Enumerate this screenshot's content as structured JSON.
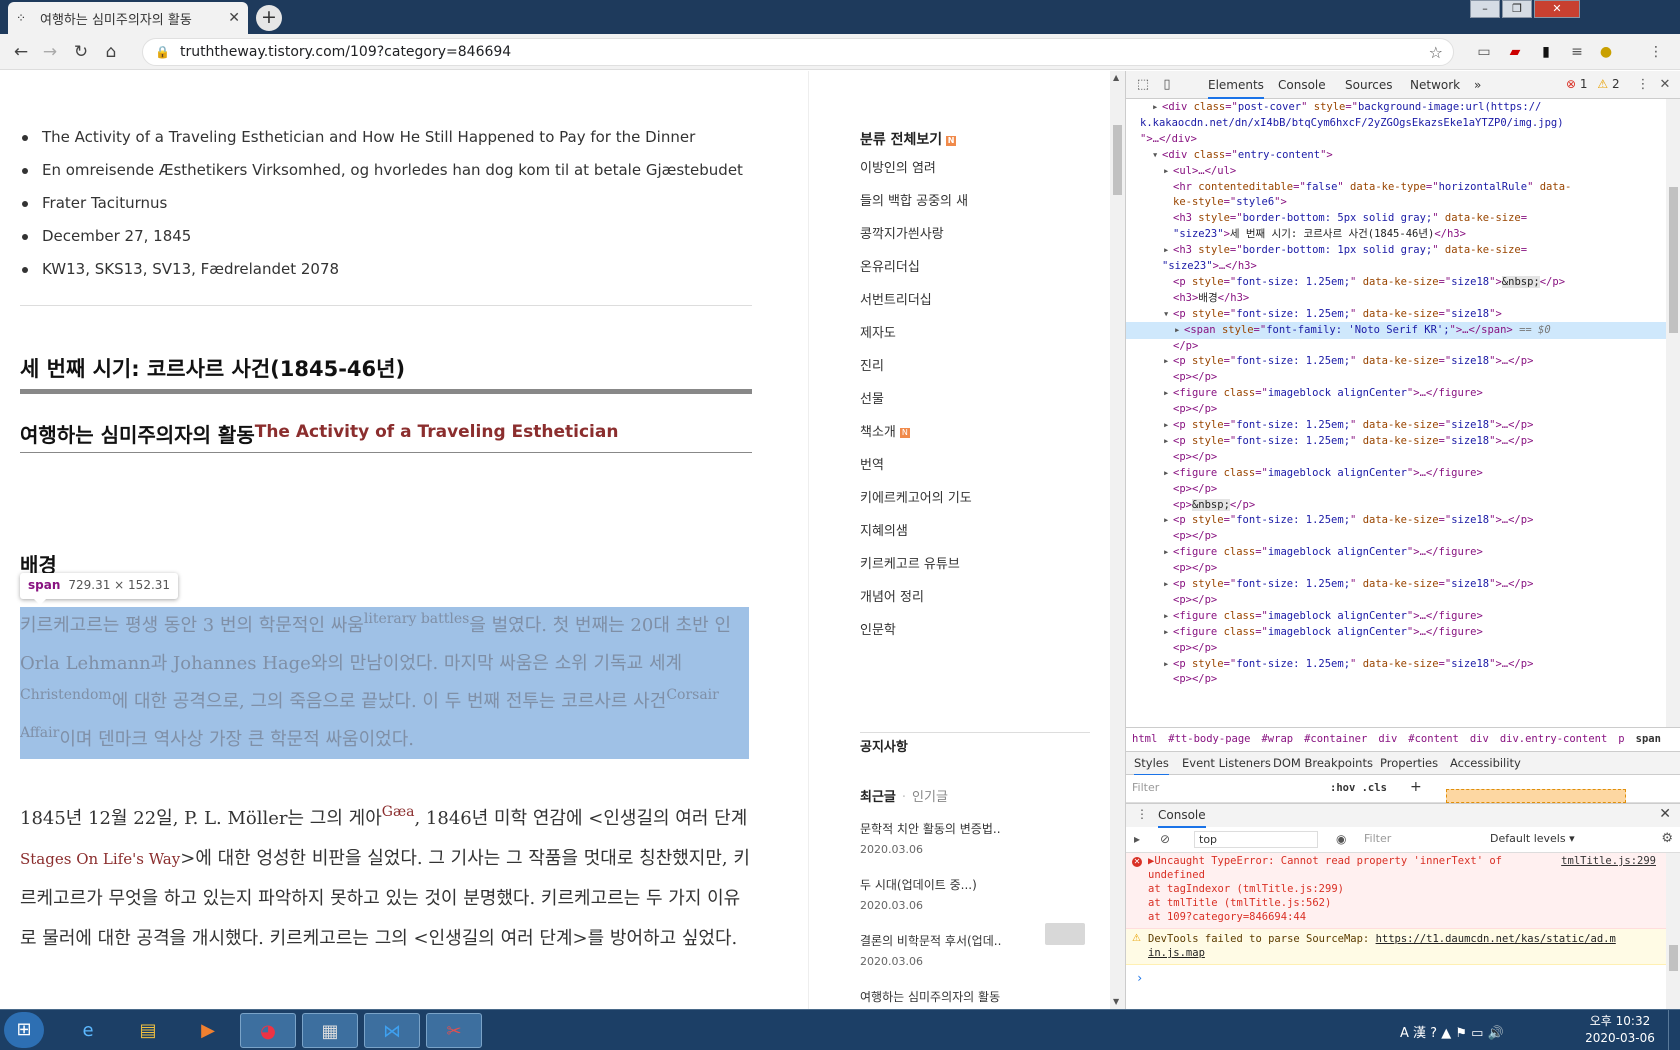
{
  "browser": {
    "tab_title": "여행하는 심미주의자의 활동",
    "url": "truththeway.tistory.com/109?category=846694",
    "new_tab_label": "+",
    "tab_close": "✕",
    "window_controls": [
      "–",
      "❐",
      "✕"
    ]
  },
  "article": {
    "meta_items": [
      "The Activity of a Traveling Esthetician and How He Still Happened to Pay for the Dinner",
      "En omreisende Æsthetikers Virksomhed, og hvorledes han dog kom til at betale Gjæstebudet",
      "Frater Taciturnus",
      "December 27, 1845",
      "KW13, SKS13, SV13, Fædrelandet 2078"
    ],
    "heading_period": "세 번째 시기: 코르사르 사건(1845-46년)",
    "heading_title": "여행하는 심미주의자의 활동",
    "heading_title_en": "The Activity of a Traveling Esthetician",
    "heading_background": "배경",
    "tooltip_tag": "span",
    "tooltip_dims": "729.31 × 152.31",
    "para1": {
      "a": "키르케고르는 평생 동안 3 번의 학문적인 싸움",
      "sup1": "literary battles",
      "b": "을 벌였다. 첫 번째는 20대 초반 인 Orla Lehmann과 Johannes Hage와의 만남이었다. 마지막 싸움은 소위 기독교 세계",
      "sup2": "Christendom",
      "c": "에 대한 공격으로, 그의 죽음으로 끝났다. 이 두 번째 전투는 코르사르 사건",
      "sup3": "Corsair Affair",
      "d": "이며 덴마크 역사상 가장 큰 학문적 싸움이었다."
    },
    "para2": {
      "a": "1845년 12월 22일, P. L. Möller는 그의 게아",
      "sup1": "Gæa",
      "b": ", 1846년 미학 연감에 <인생길의 여러 단계 ",
      "link": "Stages On Life's Way",
      "c": ">에 대한 엉성한 비판을 실었다. 그 기사는 그 작품을 멋대로 칭찬했지만, 키르케고르가 무엇을 하고 있는지 파악하지 못하고 있는 것이 분명했다. 키르케고르는 두 가지 이유로 물러에 대한 공격을 개시했다. 키르케고르는 그의 <인생길의 여러 단계>를 방어하고 싶었다."
    }
  },
  "sidebar": {
    "category_head": "분류 전체보기",
    "new_badge": "N",
    "categories": [
      "이방인의 염려",
      "들의 백합 공중의 새",
      "콩깍지가씐사랑",
      "온유리더십",
      "서번트리더십",
      "제자도",
      "진리",
      "선물",
      "책소개",
      "번역",
      "키에르케고어의 기도",
      "지혜의샘",
      "키르케고르 유튜브",
      "개념어 정리",
      "인문학"
    ],
    "notice": "공지사항",
    "recent_tab": "최근글",
    "popular_tab": "인기글",
    "recent_posts": [
      {
        "title": "문학적 치안 활동의 변증법..",
        "date": "2020.03.06"
      },
      {
        "title": "두 시대(업데이트 중...)",
        "date": "2020.03.06"
      },
      {
        "title": "결론의 비학문적 후서(업데..",
        "date": "2020.03.06"
      },
      {
        "title": "여행하는 심미주의자의 활동",
        "date": ""
      }
    ]
  },
  "devtools": {
    "tabs": [
      "Elements",
      "Console",
      "Sources",
      "Network",
      "»"
    ],
    "error_count": "1",
    "warning_count": "2",
    "dom_lines": [
      {
        "indent": 2,
        "arrow": "▶",
        "parts": [
          [
            "tagn",
            "<div "
          ],
          [
            "attr",
            "class"
          ],
          [
            "tagn",
            "=\""
          ],
          [
            "val",
            "post-cover"
          ],
          [
            "tagn",
            "\" "
          ],
          [
            "attr",
            "style"
          ],
          [
            "tagn",
            "=\""
          ],
          [
            "val",
            "background-image:url(https://"
          ]
        ]
      },
      {
        "indent": 0,
        "arrow": "",
        "parts": [
          [
            "val",
            "k.kakaocdn.net/dn/xI4bB/btqCym6hxcF/2yZGOgsEkazsEke1aYTZP0/img.jpg)"
          ]
        ]
      },
      {
        "indent": 0,
        "arrow": "",
        "parts": [
          [
            "tagn",
            "\">…</div>"
          ]
        ]
      },
      {
        "indent": 2,
        "arrow": "▼",
        "parts": [
          [
            "tagn",
            "<div "
          ],
          [
            "attr",
            "class"
          ],
          [
            "tagn",
            "=\""
          ],
          [
            "val",
            "entry-content"
          ],
          [
            "tagn",
            "\">"
          ]
        ]
      },
      {
        "indent": 3,
        "arrow": "▶",
        "parts": [
          [
            "tagn",
            "<ul>…</ul>"
          ]
        ]
      },
      {
        "indent": 3,
        "arrow": "",
        "parts": [
          [
            "tagn",
            "<hr "
          ],
          [
            "attr",
            "contenteditable"
          ],
          [
            "tagn",
            "=\""
          ],
          [
            "val",
            "false"
          ],
          [
            "tagn",
            "\" "
          ],
          [
            "attr",
            "data-ke-type"
          ],
          [
            "tagn",
            "=\""
          ],
          [
            "val",
            "horizontalRule"
          ],
          [
            "tagn",
            "\" "
          ],
          [
            "attr",
            "data-"
          ]
        ]
      },
      {
        "indent": 3,
        "arrow": "",
        "parts": [
          [
            "attr",
            "ke-style"
          ],
          [
            "tagn",
            "=\""
          ],
          [
            "val",
            "style6"
          ],
          [
            "tagn",
            "\">"
          ]
        ]
      },
      {
        "indent": 3,
        "arrow": "",
        "parts": [
          [
            "tagn",
            "<h3 "
          ],
          [
            "attr",
            "style"
          ],
          [
            "tagn",
            "=\""
          ],
          [
            "val",
            "border-bottom: 5px  solid gray;"
          ],
          [
            "tagn",
            "\" "
          ],
          [
            "attr",
            "data-ke-size"
          ],
          [
            "tagn",
            "="
          ]
        ]
      },
      {
        "indent": 3,
        "arrow": "",
        "parts": [
          [
            "val",
            "\"size23\""
          ],
          [
            "tagn",
            ">"
          ],
          [
            "txt",
            "세 번째 시기: 코르사르 사건(1845-46년)"
          ],
          [
            "tagn",
            "</h3>"
          ]
        ]
      },
      {
        "indent": 3,
        "arrow": "▶",
        "parts": [
          [
            "tagn",
            "<h3 "
          ],
          [
            "attr",
            "style"
          ],
          [
            "tagn",
            "=\""
          ],
          [
            "val",
            "border-bottom: 1px  solid gray;"
          ],
          [
            "tagn",
            "\" "
          ],
          [
            "attr",
            "data-ke-size"
          ],
          [
            "tagn",
            "="
          ]
        ]
      },
      {
        "indent": 2,
        "arrow": "",
        "parts": [
          [
            "val",
            "\"size23\""
          ],
          [
            "tagn",
            ">…</h3>"
          ]
        ]
      },
      {
        "indent": 3,
        "arrow": "",
        "parts": [
          [
            "tagn",
            "<p "
          ],
          [
            "attr",
            "style"
          ],
          [
            "tagn",
            "=\""
          ],
          [
            "val",
            "font-size: 1.25em;"
          ],
          [
            "tagn",
            "\" "
          ],
          [
            "attr",
            "data-ke-size"
          ],
          [
            "tagn",
            "=\""
          ],
          [
            "val",
            "size18"
          ],
          [
            "tagn",
            "\">"
          ],
          [
            "ent",
            "&nbsp;"
          ],
          [
            "tagn",
            "</p>"
          ]
        ]
      },
      {
        "indent": 3,
        "arrow": "",
        "parts": [
          [
            "tagn",
            "<h3>"
          ],
          [
            "txt",
            "배경"
          ],
          [
            "tagn",
            "</h3>"
          ]
        ]
      },
      {
        "indent": 3,
        "arrow": "▼",
        "parts": [
          [
            "tagn",
            "<p "
          ],
          [
            "attr",
            "style"
          ],
          [
            "tagn",
            "=\""
          ],
          [
            "val",
            "font-size: 1.25em;"
          ],
          [
            "tagn",
            "\" "
          ],
          [
            "attr",
            "data-ke-size"
          ],
          [
            "tagn",
            "=\""
          ],
          [
            "val",
            "size18"
          ],
          [
            "tagn",
            "\">"
          ]
        ]
      },
      {
        "indent": 4,
        "arrow": "▶",
        "sel": true,
        "parts": [
          [
            "tagn",
            "<span "
          ],
          [
            "attr",
            "style"
          ],
          [
            "tagn",
            "=\""
          ],
          [
            "val",
            "font-family: 'Noto Serif KR';"
          ],
          [
            "tagn",
            "\">…</span>"
          ],
          [
            "dollar",
            " == $0"
          ]
        ]
      },
      {
        "indent": 3,
        "arrow": "",
        "parts": [
          [
            "tagn",
            "</p>"
          ]
        ]
      },
      {
        "indent": 3,
        "arrow": "▶",
        "parts": [
          [
            "tagn",
            "<p "
          ],
          [
            "attr",
            "style"
          ],
          [
            "tagn",
            "=\""
          ],
          [
            "val",
            "font-size: 1.25em;"
          ],
          [
            "tagn",
            "\" "
          ],
          [
            "attr",
            "data-ke-size"
          ],
          [
            "tagn",
            "=\""
          ],
          [
            "val",
            "size18"
          ],
          [
            "tagn",
            "\">…</p>"
          ]
        ]
      },
      {
        "indent": 3,
        "arrow": "",
        "parts": [
          [
            "tagn",
            "<p></p>"
          ]
        ]
      },
      {
        "indent": 3,
        "arrow": "▶",
        "parts": [
          [
            "tagn",
            "<figure "
          ],
          [
            "attr",
            "class"
          ],
          [
            "tagn",
            "=\""
          ],
          [
            "val",
            "imageblock alignCenter"
          ],
          [
            "tagn",
            "\">…</figure>"
          ]
        ]
      },
      {
        "indent": 3,
        "arrow": "",
        "parts": [
          [
            "tagn",
            "<p></p>"
          ]
        ]
      },
      {
        "indent": 3,
        "arrow": "▶",
        "parts": [
          [
            "tagn",
            "<p "
          ],
          [
            "attr",
            "style"
          ],
          [
            "tagn",
            "=\""
          ],
          [
            "val",
            "font-size: 1.25em;"
          ],
          [
            "tagn",
            "\" "
          ],
          [
            "attr",
            "data-ke-size"
          ],
          [
            "tagn",
            "=\""
          ],
          [
            "val",
            "size18"
          ],
          [
            "tagn",
            "\">…</p>"
          ]
        ]
      },
      {
        "indent": 3,
        "arrow": "▶",
        "parts": [
          [
            "tagn",
            "<p "
          ],
          [
            "attr",
            "style"
          ],
          [
            "tagn",
            "=\""
          ],
          [
            "val",
            "font-size: 1.25em;"
          ],
          [
            "tagn",
            "\" "
          ],
          [
            "attr",
            "data-ke-size"
          ],
          [
            "tagn",
            "=\""
          ],
          [
            "val",
            "size18"
          ],
          [
            "tagn",
            "\">…</p>"
          ]
        ]
      },
      {
        "indent": 3,
        "arrow": "",
        "parts": [
          [
            "tagn",
            "<p></p>"
          ]
        ]
      },
      {
        "indent": 3,
        "arrow": "▶",
        "parts": [
          [
            "tagn",
            "<figure "
          ],
          [
            "attr",
            "class"
          ],
          [
            "tagn",
            "=\""
          ],
          [
            "val",
            "imageblock alignCenter"
          ],
          [
            "tagn",
            "\">…</figure>"
          ]
        ]
      },
      {
        "indent": 3,
        "arrow": "",
        "parts": [
          [
            "tagn",
            "<p></p>"
          ]
        ]
      },
      {
        "indent": 3,
        "arrow": "",
        "parts": [
          [
            "tagn",
            "<p>"
          ],
          [
            "ent",
            "&nbsp;"
          ],
          [
            "tagn",
            "</p>"
          ]
        ]
      },
      {
        "indent": 3,
        "arrow": "▶",
        "parts": [
          [
            "tagn",
            "<p "
          ],
          [
            "attr",
            "style"
          ],
          [
            "tagn",
            "=\""
          ],
          [
            "val",
            "font-size: 1.25em;"
          ],
          [
            "tagn",
            "\" "
          ],
          [
            "attr",
            "data-ke-size"
          ],
          [
            "tagn",
            "=\""
          ],
          [
            "val",
            "size18"
          ],
          [
            "tagn",
            "\">…</p>"
          ]
        ]
      },
      {
        "indent": 3,
        "arrow": "",
        "parts": [
          [
            "tagn",
            "<p></p>"
          ]
        ]
      },
      {
        "indent": 3,
        "arrow": "▶",
        "parts": [
          [
            "tagn",
            "<figure "
          ],
          [
            "attr",
            "class"
          ],
          [
            "tagn",
            "=\""
          ],
          [
            "val",
            "imageblock alignCenter"
          ],
          [
            "tagn",
            "\">…</figure>"
          ]
        ]
      },
      {
        "indent": 3,
        "arrow": "",
        "parts": [
          [
            "tagn",
            "<p></p>"
          ]
        ]
      },
      {
        "indent": 3,
        "arrow": "▶",
        "parts": [
          [
            "tagn",
            "<p "
          ],
          [
            "attr",
            "style"
          ],
          [
            "tagn",
            "=\""
          ],
          [
            "val",
            "font-size: 1.25em;"
          ],
          [
            "tagn",
            "\" "
          ],
          [
            "attr",
            "data-ke-size"
          ],
          [
            "tagn",
            "=\""
          ],
          [
            "val",
            "size18"
          ],
          [
            "tagn",
            "\">…</p>"
          ]
        ]
      },
      {
        "indent": 3,
        "arrow": "",
        "parts": [
          [
            "tagn",
            "<p></p>"
          ]
        ]
      },
      {
        "indent": 3,
        "arrow": "▶",
        "parts": [
          [
            "tagn",
            "<figure "
          ],
          [
            "attr",
            "class"
          ],
          [
            "tagn",
            "=\""
          ],
          [
            "val",
            "imageblock alignCenter"
          ],
          [
            "tagn",
            "\">…</figure>"
          ]
        ]
      },
      {
        "indent": 3,
        "arrow": "▶",
        "parts": [
          [
            "tagn",
            "<figure "
          ],
          [
            "attr",
            "class"
          ],
          [
            "tagn",
            "=\""
          ],
          [
            "val",
            "imageblock alignCenter"
          ],
          [
            "tagn",
            "\">…</figure>"
          ]
        ]
      },
      {
        "indent": 3,
        "arrow": "",
        "parts": [
          [
            "tagn",
            "<p></p>"
          ]
        ]
      },
      {
        "indent": 3,
        "arrow": "▶",
        "parts": [
          [
            "tagn",
            "<p "
          ],
          [
            "attr",
            "style"
          ],
          [
            "tagn",
            "=\""
          ],
          [
            "val",
            "font-size: 1.25em;"
          ],
          [
            "tagn",
            "\" "
          ],
          [
            "attr",
            "data-ke-size"
          ],
          [
            "tagn",
            "=\""
          ],
          [
            "val",
            "size18"
          ],
          [
            "tagn",
            "\">…</p>"
          ]
        ]
      },
      {
        "indent": 3,
        "arrow": "",
        "parts": [
          [
            "tagn",
            "<p></p>"
          ]
        ]
      }
    ],
    "breadcrumbs": [
      "html",
      "#tt-body-page",
      "#wrap",
      "#container",
      "div",
      "#content",
      "div",
      "div.entry-content",
      "p",
      "span"
    ],
    "styles_tabs": [
      "Styles",
      "Event Listeners",
      "DOM Breakpoints",
      "Properties",
      "Accessibility"
    ],
    "filter_placeholder": "Filter",
    "hov_cls": ":hov  .cls",
    "console_title": "Console",
    "console_context": "top",
    "console_filter": "Filter",
    "console_levels": "Default levels ▾",
    "error_lines": [
      "▶Uncaught TypeError: Cannot read property 'innerText' of",
      "undefined",
      "    at tagIndexor (tmlTitle.js:299)",
      "    at tmlTitle (tmlTitle.js:562)",
      "    at 109?category=846694:44"
    ],
    "error_source": "tmlTitle.js:299",
    "warn_text": "DevTools failed to parse SourceMap: ",
    "warn_link1": "https://t1.daumcdn.net/kas/static/ad.m",
    "warn_link2": "in.js.map",
    "prompt": "›"
  },
  "taskbar": {
    "time": "오후 10:32",
    "date": "2020-03-06",
    "tray": "A 漢 ? ▲ ⚑ ▭ 🔊"
  }
}
